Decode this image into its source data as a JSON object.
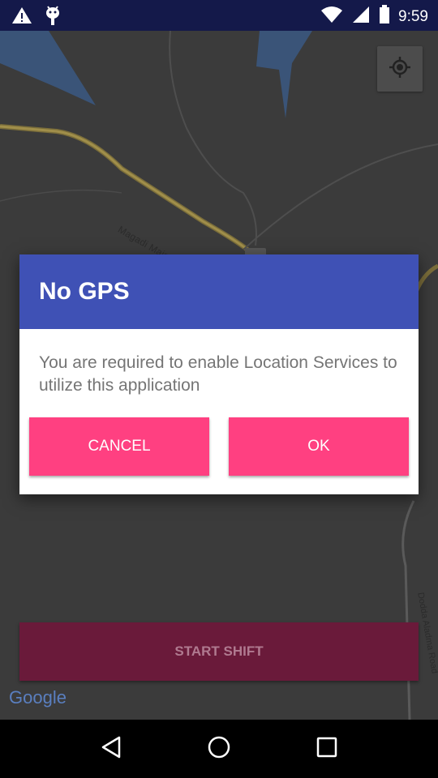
{
  "status_bar": {
    "time": "9:59",
    "icons": [
      "warning-icon",
      "android-debug-icon",
      "wifi-icon",
      "signal-icon",
      "battery-icon"
    ]
  },
  "map": {
    "road_label": "Magadi Main Rd",
    "road_label_2": "Dodda Aladma Road",
    "google_logo": "Google",
    "my_location_icon": "my-location-icon"
  },
  "start_shift": {
    "label": "START SHIFT"
  },
  "dialog": {
    "title": "No GPS",
    "message": "You are required to enable Location Services to utilize this application",
    "cancel_label": "CANCEL",
    "ok_label": "OK"
  },
  "colors": {
    "dialog_header": "#3f51b5",
    "dialog_button": "#ff4081",
    "status_bar": "#14194a"
  },
  "nav_bar": {
    "icons": [
      "back-icon",
      "home-icon",
      "recents-icon"
    ]
  }
}
